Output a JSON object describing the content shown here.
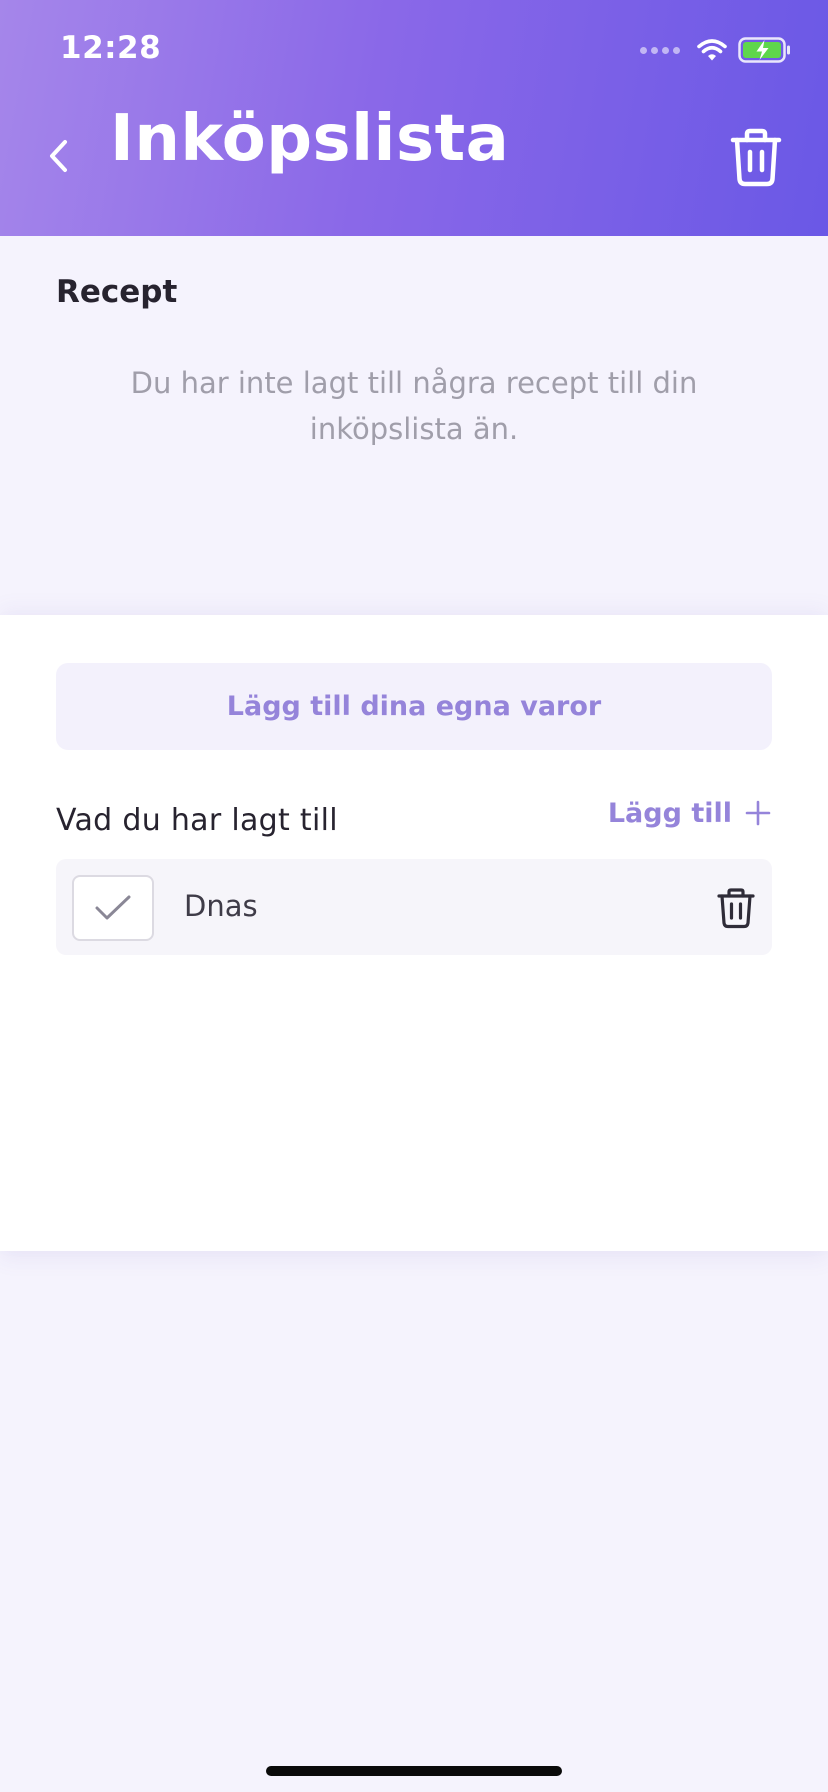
{
  "status_bar": {
    "time": "12:28"
  },
  "header": {
    "title": "Inköpslista",
    "back_icon": "chevron-left-icon",
    "delete_icon": "trash-icon"
  },
  "recipes": {
    "title": "Recept",
    "empty_message": "Du har inte lagt till några recept till din inköpslista än."
  },
  "own_items": {
    "add_own_button_label": "Lägg till dina egna varor",
    "added_heading": "Vad du har lagt till",
    "add_link_label": "Lägg till",
    "items": [
      {
        "label": "Dnas",
        "checked": true
      }
    ]
  },
  "colors": {
    "header_gradient_start": "#a586ea",
    "header_gradient_end": "#6a58e6",
    "accent": "#9584da",
    "background": "#f5f3fd",
    "battery_green": "#5fd64c"
  }
}
